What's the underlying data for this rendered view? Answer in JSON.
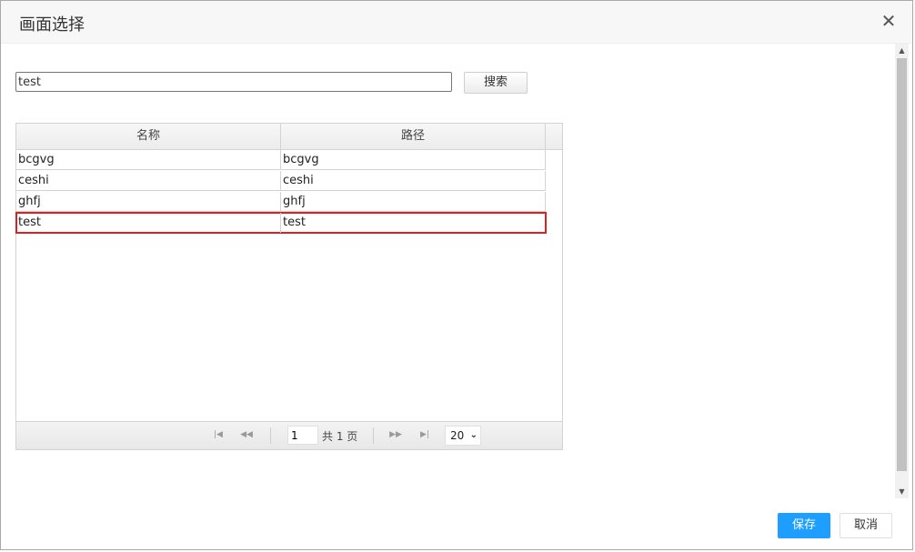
{
  "dialog": {
    "title": "画面选择",
    "close_icon": "close-icon"
  },
  "search": {
    "value": "test",
    "button_label": "搜索"
  },
  "grid": {
    "columns": [
      "名称",
      "路径"
    ],
    "rows": [
      {
        "name": "bcgvg",
        "path": "bcgvg"
      },
      {
        "name": "ceshi",
        "path": "ceshi"
      },
      {
        "name": "ghfj",
        "path": "ghfj"
      },
      {
        "name": "test",
        "path": "test",
        "selected": true
      }
    ],
    "selection_outline_color": "#e02020"
  },
  "pager": {
    "first_icon": "first-page-icon",
    "prev_icon": "prev-page-icon",
    "next_icon": "next-page-icon",
    "last_icon": "last-page-icon",
    "current_page": "1",
    "total_text": "共 1 页",
    "page_size": "20"
  },
  "footer": {
    "save_label": "保存",
    "cancel_label": "取消",
    "save_color": "#1e9fff"
  }
}
